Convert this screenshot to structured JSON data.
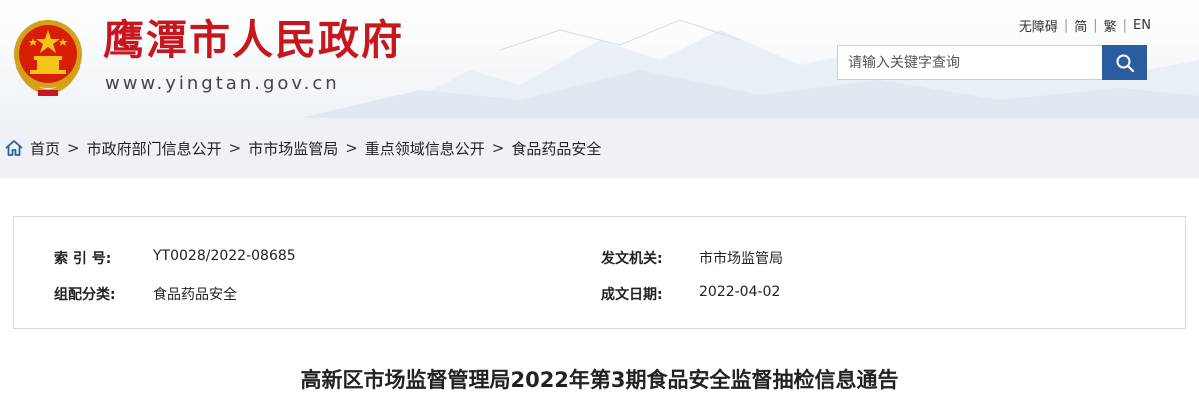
{
  "header": {
    "site_title": "鹰潭市人民政府",
    "site_url": "www.yingtan.gov.cn",
    "top_links": [
      "无障碍",
      "简",
      "繁",
      "EN"
    ],
    "search_placeholder": "请输入关键字查询"
  },
  "breadcrumb": {
    "items": [
      "首页",
      "市政府部门信息公开",
      "市市场监管局",
      "重点领域信息公开",
      "食品药品安全"
    ],
    "separator": ">"
  },
  "info": {
    "index_label": "索 引 号:",
    "index_value": "YT0028/2022-08685",
    "issuer_label": "发文机关:",
    "issuer_value": "市市场监管局",
    "category_label": "组配分类:",
    "category_value": "食品药品安全",
    "date_label": "成文日期:",
    "date_value": "2022-04-02"
  },
  "article": {
    "title": "高新区市场监督管理局2022年第3期食品安全监督抽检信息通告"
  },
  "colors": {
    "brand_red": "#c8161d",
    "search_button": "#2a5d9f",
    "breadcrumb_bg": "#eef2f7"
  }
}
